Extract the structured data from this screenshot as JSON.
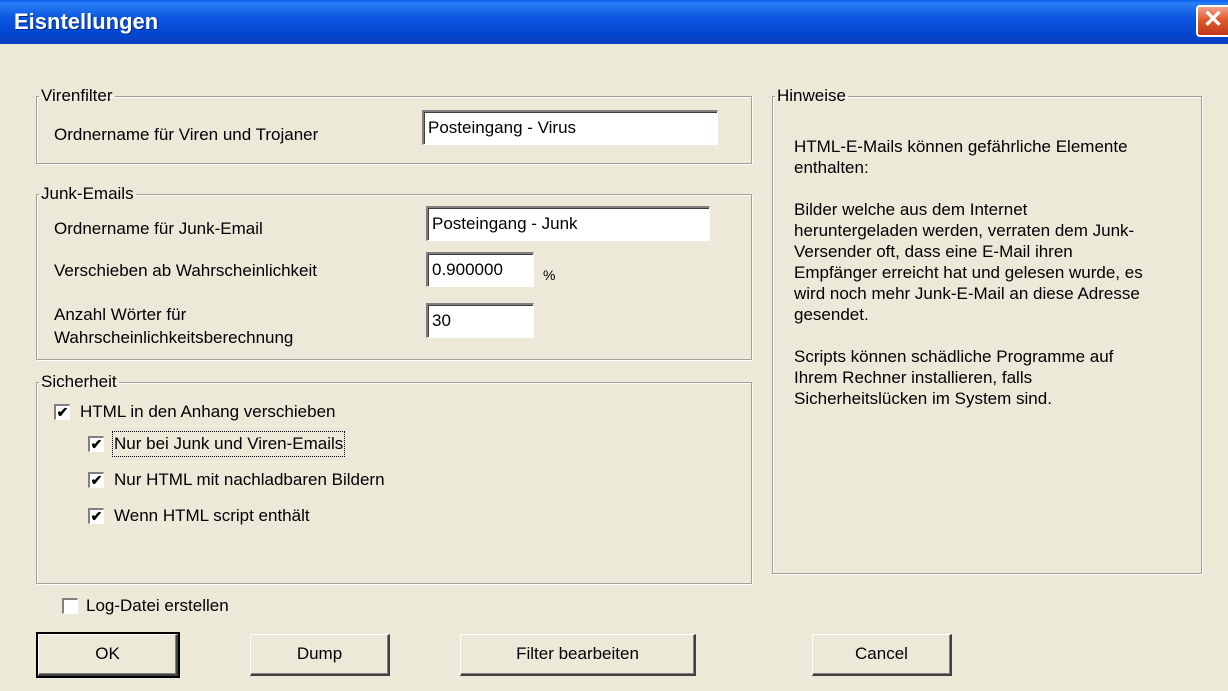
{
  "window": {
    "title": "Eisntellungen",
    "close_symbol": "✕"
  },
  "virenfilter": {
    "legend": "Virenfilter",
    "folder_label": "Ordnername für Viren und Trojaner",
    "folder_value": "Posteingang - Virus"
  },
  "junk": {
    "legend": "Junk-Emails",
    "folder_label": "Ordnername für Junk-Email",
    "folder_value": "Posteingang - Junk",
    "prob_label": "Verschieben ab Wahrscheinlichkeit",
    "prob_value": "0.900000",
    "prob_unit": "%",
    "words_label_1": "Anzahl Wörter für",
    "words_label_2": "Wahrscheinlichkeitsberechnung",
    "words_value": "30"
  },
  "sicherheit": {
    "legend": "Sicherheit",
    "options": [
      {
        "label": "HTML in den Anhang verschieben",
        "checked": true
      },
      {
        "label": "Nur bei Junk und Viren-Emails",
        "checked": true
      },
      {
        "label": "Nur HTML mit nachladbaren Bildern",
        "checked": true
      },
      {
        "label": "Wenn HTML script enthält",
        "checked": true
      }
    ]
  },
  "hinweise": {
    "legend": "Hinweise",
    "paragraphs": [
      "HTML-E-Mails können gefährliche Elemente enthalten:",
      "Bilder welche aus dem Internet heruntergeladen werden, verraten dem Junk-Versender oft, dass eine E-Mail ihren Empfänger erreicht hat und gelesen wurde, es wird noch mehr Junk-E-Mail an diese Adresse gesendet.",
      "Scripts können schädliche Programme auf Ihrem Rechner installieren, falls Sicherheitslücken im System sind."
    ]
  },
  "log": {
    "label": "Log-Datei erstellen",
    "checked": false
  },
  "buttons": {
    "ok": "OK",
    "dump": "Dump",
    "filter": "Filter bearbeiten",
    "cancel": "Cancel"
  },
  "check_symbol": "✔"
}
